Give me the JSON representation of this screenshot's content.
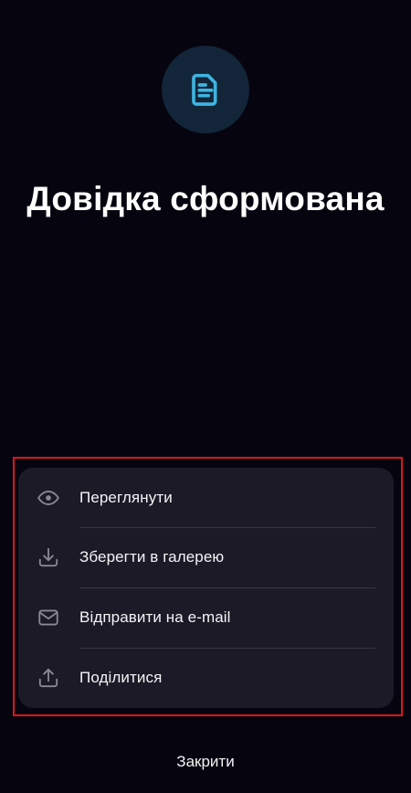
{
  "header": {
    "icon": "document-icon",
    "title": "Довідка сформована"
  },
  "actions": [
    {
      "label": "Переглянути",
      "icon": "eye-icon"
    },
    {
      "label": "Зберегти в галерею",
      "icon": "download-icon"
    },
    {
      "label": "Відправити на e-mail",
      "icon": "mail-icon"
    },
    {
      "label": "Поділитися",
      "icon": "share-icon"
    }
  ],
  "footer": {
    "close_label": "Закрити"
  },
  "colors": {
    "background": "#06040f",
    "card": "#1c1a26",
    "accent": "#3fb3e0",
    "badge": "#132538",
    "highlight": "#e0141a"
  }
}
